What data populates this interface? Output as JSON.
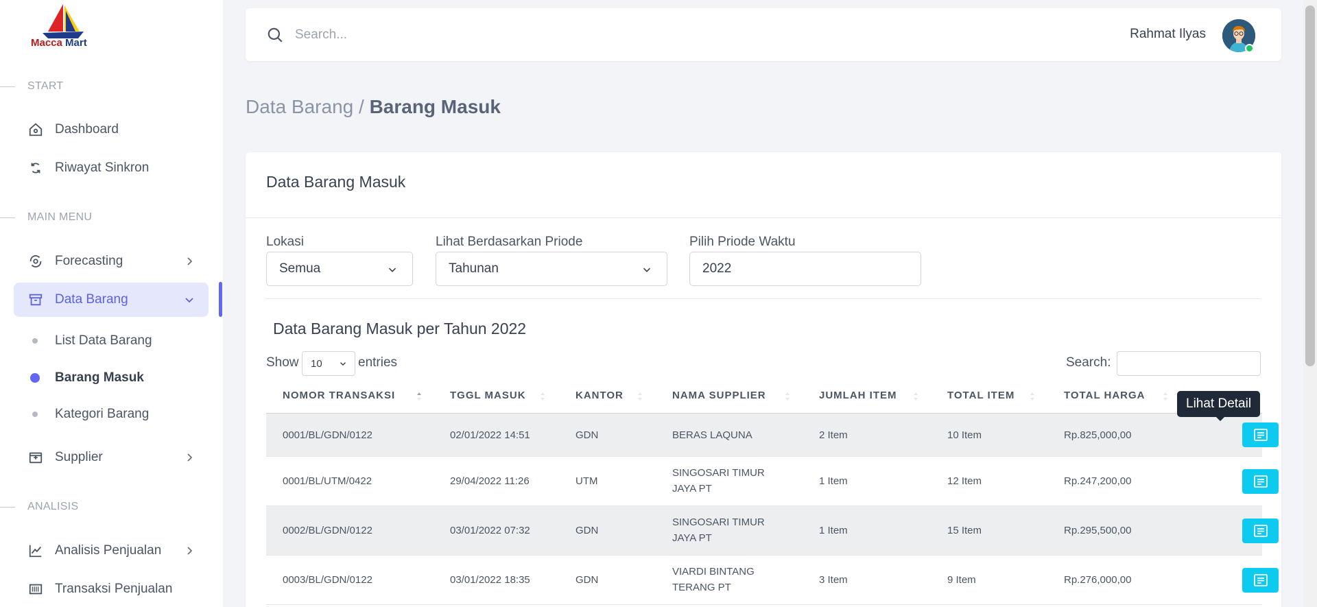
{
  "brand": {
    "name_part1": "Macca",
    "name_part2": "Mart"
  },
  "sidebar": {
    "sections": {
      "start": "START",
      "main": "MAIN MENU",
      "analysis": "ANALISIS"
    },
    "items": {
      "dashboard": "Dashboard",
      "riwayat": "Riwayat Sinkron",
      "forecasting": "Forecasting",
      "data_barang": "Data Barang",
      "supplier": "Supplier",
      "analisis_penjualan": "Analisis Penjualan",
      "transaksi_penjualan": "Transaksi Penjualan"
    },
    "sub_items": {
      "list": "List Data Barang",
      "masuk": "Barang Masuk",
      "kategori": "Kategori Barang"
    }
  },
  "topbar": {
    "search_placeholder": "Search...",
    "user_name": "Rahmat Ilyas"
  },
  "breadcrumb": {
    "parent": "Data Barang /",
    "current": "Barang Masuk"
  },
  "card": {
    "title": "Data Barang Masuk"
  },
  "filters": {
    "lokasi": {
      "label": "Lokasi",
      "value": "Semua"
    },
    "periode": {
      "label": "Lihat Berdasarkan Priode",
      "value": "Tahunan"
    },
    "waktu": {
      "label": "Pilih Priode Waktu",
      "value": "2022"
    }
  },
  "table": {
    "title": "Data Barang Masuk per Tahun 2022",
    "show_label": "Show",
    "entries_value": "10",
    "entries_label": "entries",
    "search_label": "Search:",
    "headers": [
      "NOMOR TRANSAKSI",
      "TGGL MASUK",
      "KANTOR",
      "NAMA SUPPLIER",
      "JUMLAH ITEM",
      "TOTAL ITEM",
      "TOTAL HARGA"
    ],
    "rows": [
      {
        "nomor": "0001/BL/GDN/0122",
        "tanggal": "02/01/2022 14:51",
        "kantor": "GDN",
        "supplier_l1": "BERAS LAQUNA",
        "supplier_l2": "",
        "jumlah": "2 Item",
        "total_item": "10 Item",
        "total_harga": "Rp.825,000,00"
      },
      {
        "nomor": "0001/BL/UTM/0422",
        "tanggal": "29/04/2022 11:26",
        "kantor": "UTM",
        "supplier_l1": "SINGOSARI TIMUR",
        "supplier_l2": "JAYA PT",
        "jumlah": "1 Item",
        "total_item": "12 Item",
        "total_harga": "Rp.247,200,00"
      },
      {
        "nomor": "0002/BL/GDN/0122",
        "tanggal": "03/01/2022 07:32",
        "kantor": "GDN",
        "supplier_l1": "SINGOSARI TIMUR",
        "supplier_l2": "JAYA PT",
        "jumlah": "1 Item",
        "total_item": "15 Item",
        "total_harga": "Rp.295,500,00"
      },
      {
        "nomor": "0003/BL/GDN/0122",
        "tanggal": "03/01/2022 18:35",
        "kantor": "GDN",
        "supplier_l1": "VIARDI BINTANG",
        "supplier_l2": "TERANG PT",
        "jumlah": "3 Item",
        "total_item": "9 Item",
        "total_harga": "Rp.276,000,00"
      }
    ],
    "tooltip": "Lihat Detail"
  },
  "colors": {
    "accent": "#6366f1",
    "active_bg": "#e5e7fd",
    "info_button": "#0dcaf0",
    "logo_red": "#b91c1c",
    "logo_navy": "#1e3a8a"
  }
}
